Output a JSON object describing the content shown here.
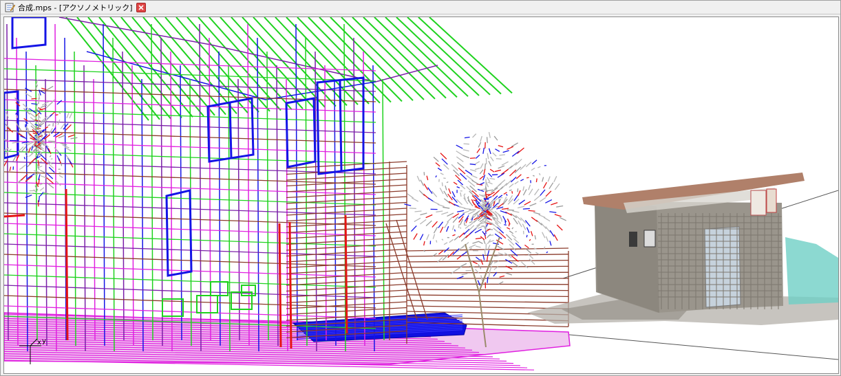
{
  "window": {
    "title": "合成.mps - [アクソノメトリック]"
  },
  "icons": {
    "app": "document-edit-icon",
    "close": "close-icon",
    "axes": "axis-triad-icon"
  },
  "axes": {
    "x_label": "x",
    "y_label": "y"
  },
  "colors": {
    "roof_green": "#1ed21e",
    "wire_magenta": "#e020e0",
    "wire_blue": "#1414e6",
    "wire_purple": "#7a1ea8",
    "wire_red": "#e61414",
    "wire_brown": "#8a3a2a",
    "tree_grey": "#b8b8b8",
    "ground_grey": "#b4b0aa"
  }
}
